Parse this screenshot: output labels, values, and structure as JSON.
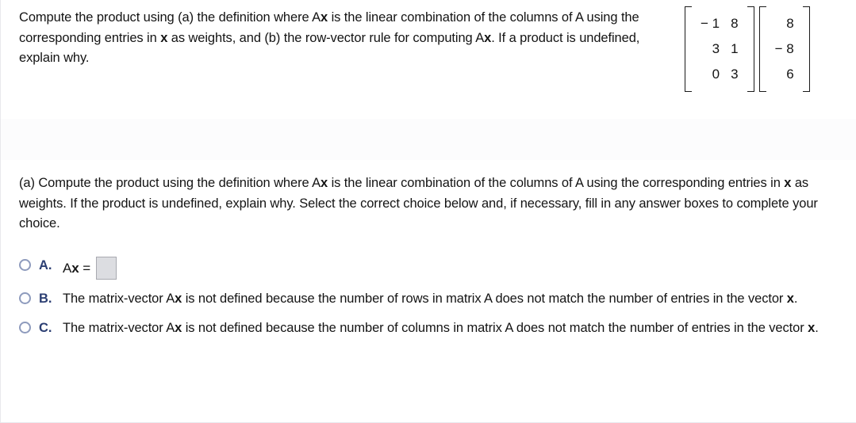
{
  "problem": {
    "text_part1": "Compute the product using (a) the definition where A",
    "bold_x_1": "x",
    "text_part2": " is the linear combination of the columns of A using the corresponding entries in ",
    "bold_x_2": "x",
    "text_part3": " as weights, and (b) the row-vector rule for computing A",
    "bold_x_3": "x",
    "text_part4": ". If a product is undefined, explain why.",
    "full_text": "Compute the product using (a) the definition where Ax is the linear combination of the columns of A using the corresponding entries in x as weights, and (b) the row-vector rule for computing Ax. If a product is undefined, explain why."
  },
  "matrix_a": {
    "name": "A",
    "rows": 3,
    "cols": 2,
    "values": [
      [
        "− 1",
        "8"
      ],
      [
        "3",
        "1"
      ],
      [
        "0",
        "3"
      ]
    ]
  },
  "vector_x": {
    "name": "x",
    "rows": 3,
    "cols": 1,
    "values": [
      [
        "8"
      ],
      [
        "− 8"
      ],
      [
        "6"
      ]
    ]
  },
  "part_a": {
    "prompt_1": "(a) Compute the product using the definition where A",
    "prompt_bold_1": "x",
    "prompt_2": " is the linear combination of the columns of A using the corresponding entries in ",
    "prompt_bold_2": "x",
    "prompt_3": " as weights. If the product is undefined, explain why. Select the correct choice below and, if necessary, fill in any answer boxes to complete your choice.",
    "full_prompt": "(a) Compute the product using the definition where Ax is the linear combination of the columns of A using the corresponding entries in x as weights. If the product is undefined, explain why. Select the correct choice below and, if necessary, fill in any answer boxes to complete your choice."
  },
  "choices": [
    {
      "letter": "A.",
      "kind": "equation",
      "eq_prefix": "A",
      "eq_bold": "x",
      "eq_suffix": " =",
      "answer_value": "",
      "answer_placeholder": "",
      "selected": false
    },
    {
      "letter": "B.",
      "kind": "text",
      "text_1": "The matrix-vector A",
      "text_bold_1": "x",
      "text_2": " is not defined because the number of rows in matrix A does not match the number of entries in the vector ",
      "text_bold_2": "x",
      "text_3": ".",
      "full_text": "The matrix-vector Ax is not defined because the number of rows in matrix A does not match the number of entries in the vector x.",
      "selected": false
    },
    {
      "letter": "C.",
      "kind": "text",
      "text_1": "The matrix-vector A",
      "text_bold_1": "x",
      "text_2": " is not defined because the number of columns in matrix A does not match the number of entries in the vector ",
      "text_bold_2": "x",
      "text_3": ".",
      "full_text": "The matrix-vector Ax is not defined because the number of columns in matrix A does not match the number of entries in the vector x.",
      "selected": false
    }
  ],
  "colors": {
    "page_bg": "#ffffff",
    "text": "#141414",
    "choice_letter": "#2c3f73",
    "radio_border": "#8e9bbd",
    "answer_box_fill": "#dcdde1",
    "answer_box_border": "#a8a9b0",
    "separator": "#f1f1f4"
  }
}
